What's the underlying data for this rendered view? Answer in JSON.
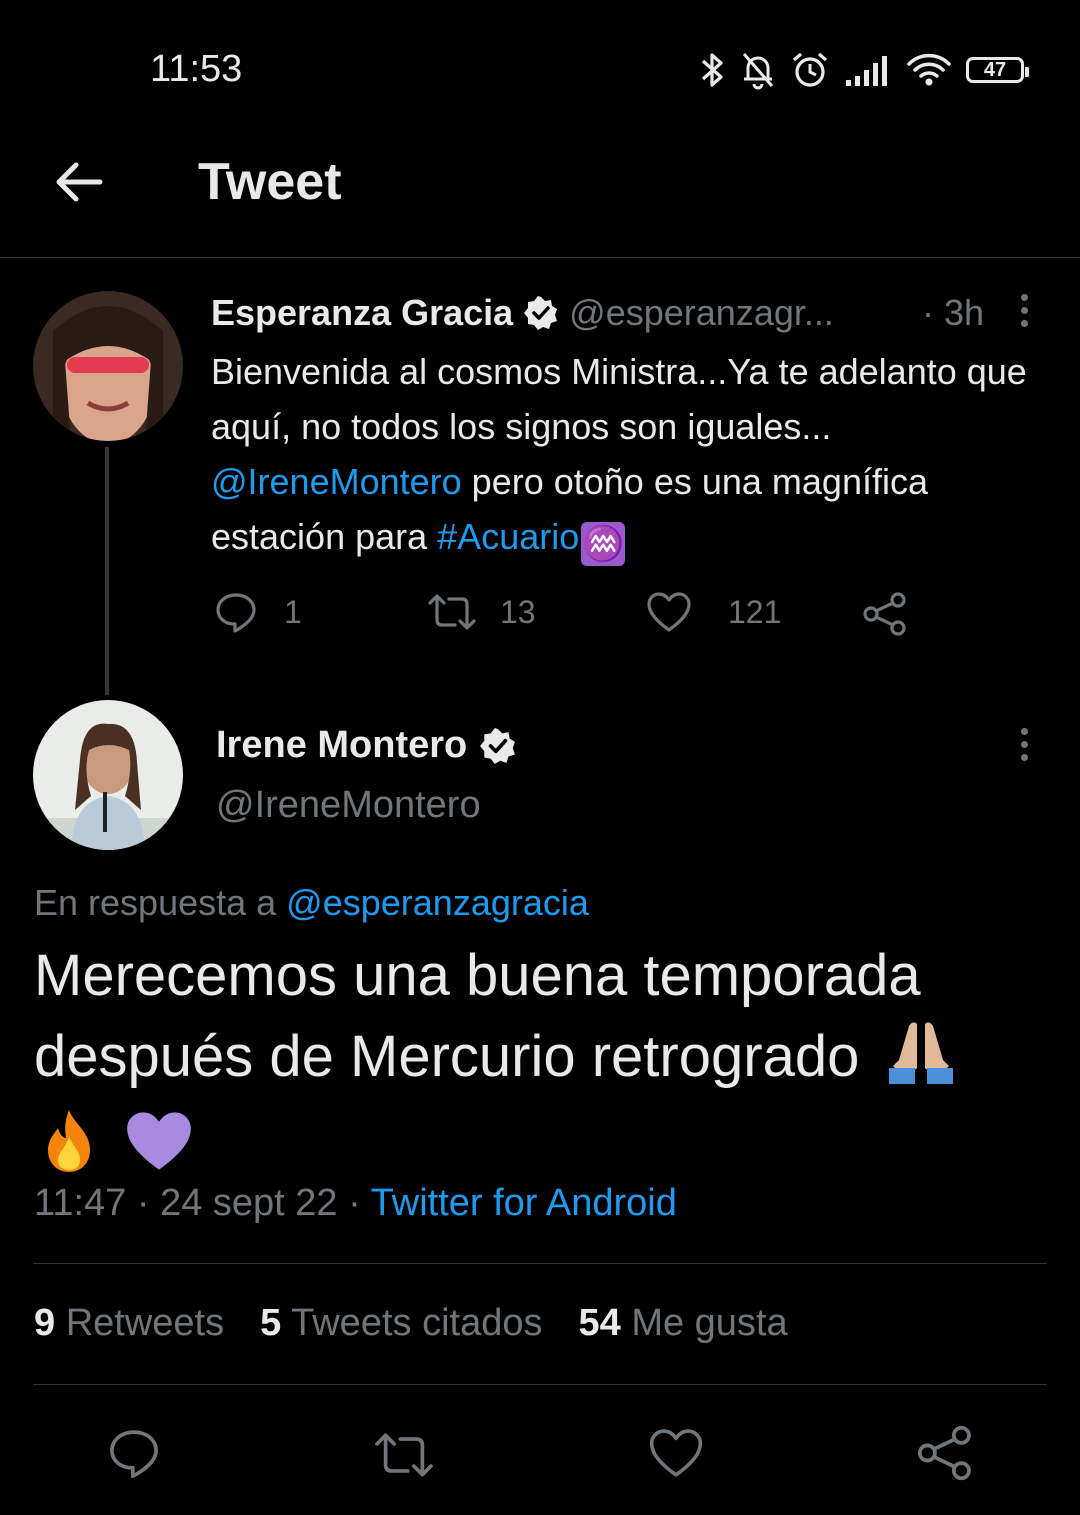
{
  "status_bar": {
    "time": "11:53",
    "battery": "47"
  },
  "header": {
    "title": "Tweet"
  },
  "parent_tweet": {
    "name": "Esperanza Gracia",
    "handle": "@esperanzagr...",
    "separator": "·",
    "time": "3h",
    "text_1": "Bienvenida al cosmos Ministra...Ya te adelanto que aquí, no todos los signos son iguales... ",
    "mention": "@IreneMontero",
    "text_2": " pero otoño es una magnífica estación para ",
    "hashtag": "#Acuario",
    "zodiac_emoji": "♒",
    "replies": "1",
    "retweets": "13",
    "likes": "121"
  },
  "main_tweet": {
    "name": "Irene Montero",
    "handle": "@IreneMontero",
    "reply_prefix": "En respuesta a",
    "reply_to": "@esperanzagracia",
    "text": "Merecemos una buena temporada después de Mercurio retrogrado",
    "emojis": [
      "folded-hands",
      "fire",
      "purple-heart"
    ],
    "time": "11:47",
    "date": "24 sept 22",
    "sep": "·",
    "source": "Twitter for Android",
    "retweets_count": "9",
    "retweets_label": "Retweets",
    "quotes_count": "5",
    "quotes_label": "Tweets citados",
    "likes_count": "54",
    "likes_label": "Me gusta"
  },
  "colors": {
    "accent": "#1d9bf0",
    "muted": "#71767b",
    "text": "#e7e9ea",
    "background": "#000000"
  }
}
